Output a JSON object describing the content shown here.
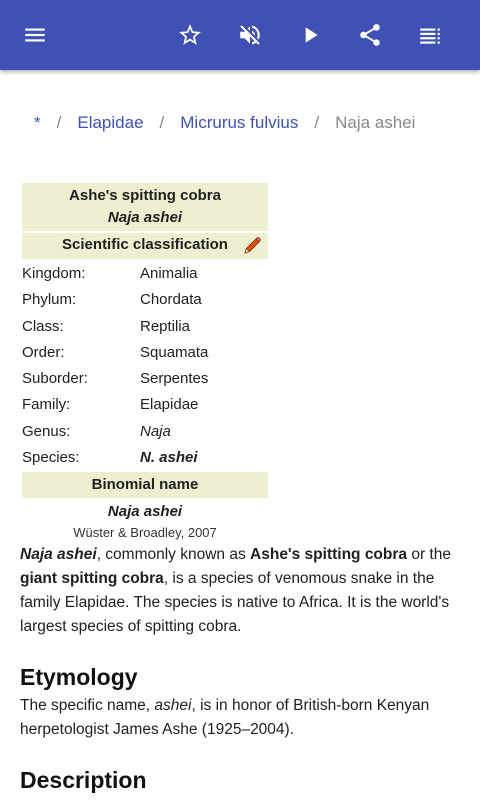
{
  "appbar": {
    "color": "#3f51b5",
    "icons": [
      "menu-icon",
      "star-icon",
      "mute-icon",
      "play-icon",
      "share-icon",
      "playlist-icon"
    ]
  },
  "breadcrumb": {
    "items": [
      "*",
      "Elapidae",
      "Micrurus fulvius"
    ],
    "separator": "/",
    "current": "Naja ashei"
  },
  "infobox": {
    "title": "Ashe's spitting cobra",
    "latin": "Naja ashei",
    "section": "Scientific classification",
    "rows": [
      {
        "key": "Kingdom:",
        "value": "Animalia"
      },
      {
        "key": "Phylum:",
        "value": "Chordata"
      },
      {
        "key": "Class:",
        "value": "Reptilia"
      },
      {
        "key": "Order:",
        "value": "Squamata"
      },
      {
        "key": "Suborder:",
        "value": "Serpentes"
      },
      {
        "key": "Family:",
        "value": "Elapidae"
      },
      {
        "key": "Genus:",
        "value": "Naja"
      },
      {
        "key": "Species:",
        "value": "N. ashei"
      }
    ],
    "binomial_header": "Binomial name",
    "binomial_name": "Naja ashei",
    "authority": "Wüster & Broadley, 2007"
  },
  "intro": {
    "name_italic": "Naja ashei",
    "t1": ", commonly known as ",
    "b1": "Ashe's spitting cobra",
    "t2": " or the ",
    "b2": "giant spitting cobra",
    "t3": ", is a species of venomous snake in the family Elapidae. The species is native to Africa. It is the world's largest species of spitting cobra."
  },
  "etymology": {
    "heading": "Etymology",
    "t1": "The specific name, ",
    "i1": "ashei",
    "t2": ", is in honor of British-born Kenyan herpetologist James Ashe (1925–2004)."
  },
  "description": {
    "heading": "Description"
  }
}
